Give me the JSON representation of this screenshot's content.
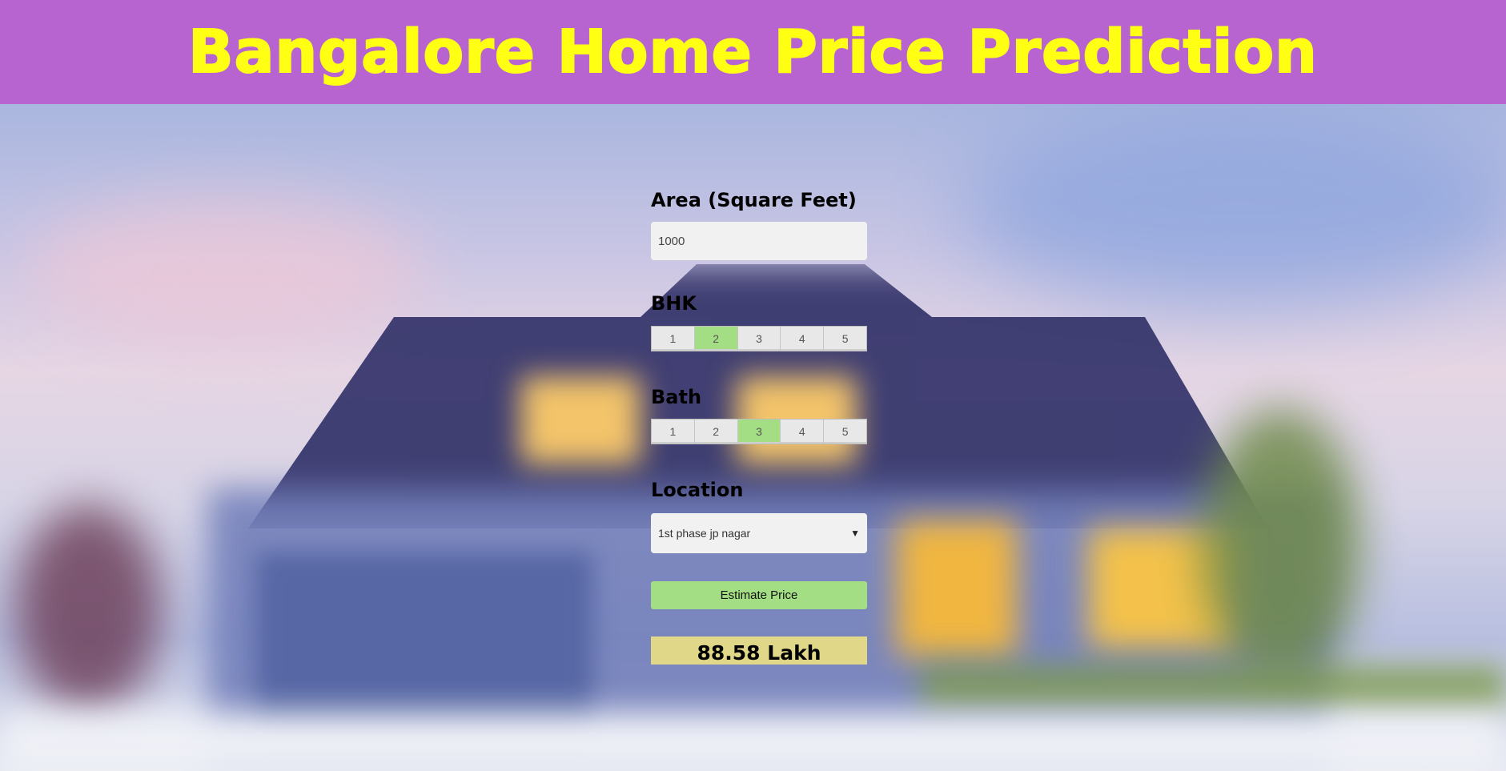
{
  "header": {
    "title": "Bangalore Home Price Prediction"
  },
  "form": {
    "area_label": "Area (Square Feet)",
    "area_value": "1000",
    "bhk_label": "BHK",
    "bhk_options": [
      "1",
      "2",
      "3",
      "4",
      "5"
    ],
    "bhk_selected": "2",
    "bath_label": "Bath",
    "bath_options": [
      "1",
      "2",
      "3",
      "4",
      "5"
    ],
    "bath_selected": "3",
    "location_label": "Location",
    "location_selected": "1st phase jp nagar",
    "estimate_label": "Estimate Price",
    "result_text": "88.58 Lakh"
  },
  "colors": {
    "header_bg": "#b864d0",
    "title": "#ffff14",
    "selected_option": "#a3de84",
    "result_bg": "#e0d888"
  }
}
